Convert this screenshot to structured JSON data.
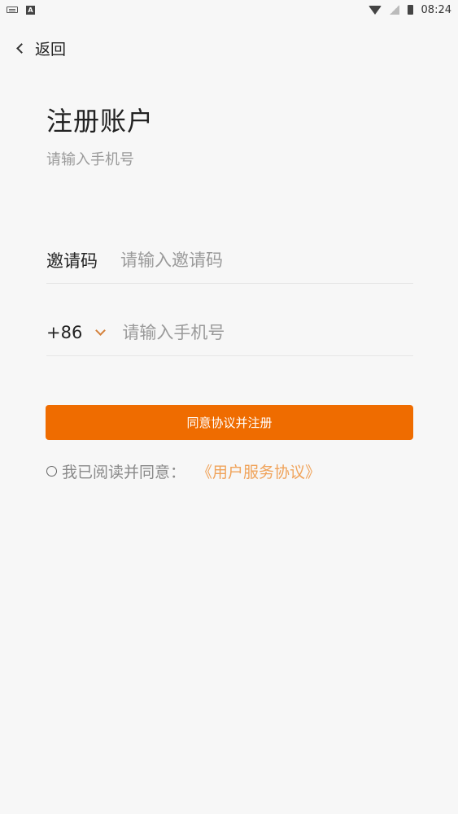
{
  "status_bar": {
    "time": "08:24"
  },
  "nav": {
    "back_label": "返回"
  },
  "header": {
    "title": "注册账户",
    "subtitle": "请输入手机号"
  },
  "form": {
    "invite": {
      "label": "邀请码",
      "placeholder": "请输入邀请码",
      "value": ""
    },
    "phone": {
      "country_code": "+86",
      "placeholder": "请输入手机号",
      "value": ""
    },
    "submit_label": "同意协议并注册"
  },
  "agreement": {
    "text": "我已阅读并同意：",
    "link": "《用户服务协议》",
    "checked": false
  },
  "colors": {
    "accent": "#ef6c00",
    "link": "#f0a35a",
    "background": "#f7f7f7"
  }
}
